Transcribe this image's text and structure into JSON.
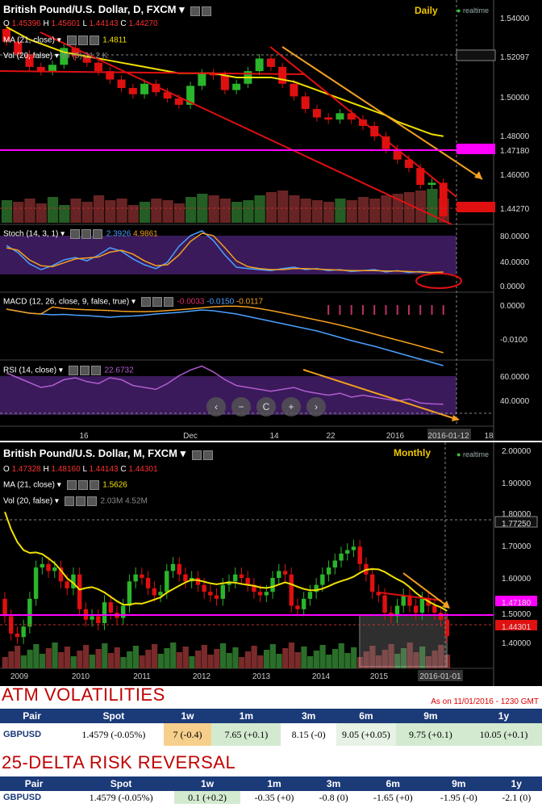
{
  "daily": {
    "title": "British Pound/U.S. Dollar, D, FXCM",
    "timeframe": "Daily",
    "realtime": "realtime",
    "ohlc": {
      "o_label": "O",
      "o": "1.45396",
      "h_label": "H",
      "h": "1.45601",
      "l_label": "L",
      "l": "1.44143",
      "c_label": "C",
      "c": "1.44270"
    },
    "ma_label": "MA (21, close)",
    "ma_value": "1.4811",
    "vol_label": "Vol (20, false)",
    "vol_values": "24 (5) 21.2 K",
    "stoch_label": "Stoch (14, 3, 1)",
    "stoch_values": [
      "2.3926",
      "4.9861"
    ],
    "macd_label": "MACD (12, 26, close, 9, false, true)",
    "macd_values": [
      "-0.0033",
      "-0.0150",
      "-0.0117"
    ],
    "rsi_label": "RSI (14, close)",
    "rsi_value": "22.6732",
    "x_labels": [
      "16",
      "Dec",
      "14",
      "22",
      "2016",
      "2016-01-12",
      "18"
    ],
    "price_axis": [
      "1.54000",
      "1.52097",
      "1.50000",
      "1.48000",
      "1.47180",
      "1.46000",
      "1.44270"
    ],
    "stoch_axis": [
      "80.0000",
      "40.0000",
      "0.0000"
    ],
    "macd_axis": [
      "0.0000",
      "-0.0100"
    ],
    "rsi_axis": [
      "60.0000",
      "40.0000"
    ]
  },
  "monthly": {
    "title": "British Pound/U.S. Dollar, M, FXCM",
    "timeframe": "Monthly",
    "realtime": "realtime",
    "ohlc": {
      "o_label": "O",
      "o": "1.47328",
      "h_label": "H",
      "h": "1.48160",
      "l_label": "L",
      "l": "1.44143",
      "c_label": "C",
      "c": "1.44301"
    },
    "ma_label": "MA (21, close)",
    "ma_value": "1.5626",
    "vol_label": "Vol (20, false)",
    "vol_values": "2.03M 4.52M",
    "x_labels": [
      "2009",
      "2010",
      "2011",
      "2012",
      "2013",
      "2014",
      "2015",
      "2016-01-01"
    ],
    "price_axis": [
      "2.00000",
      "1.90000",
      "1.80000",
      "1.77250",
      "1.70000",
      "1.60000",
      "1.50000",
      "1.47180",
      "1.44301",
      "1.40000"
    ]
  },
  "chart_data": [
    {
      "type": "line",
      "title": "British Pound/U.S. Dollar, D, FXCM",
      "series": [
        {
          "name": "Close",
          "values": [
            1.526,
            1.52,
            1.514,
            1.512,
            1.515,
            1.523,
            1.519,
            1.516,
            1.512,
            1.508,
            1.504,
            1.501,
            1.506,
            1.502,
            1.499,
            1.496,
            1.505,
            1.511,
            1.51,
            1.503,
            1.506,
            1.512,
            1.518,
            1.514,
            1.506,
            1.5,
            1.494,
            1.49,
            1.489,
            1.492,
            1.489,
            1.486,
            1.481,
            1.475,
            1.47,
            1.466,
            1.458,
            1.459,
            1.443
          ]
        },
        {
          "name": "MA (21, close)",
          "values": [
            1.533,
            1.53,
            1.527,
            1.525,
            1.523,
            1.521,
            1.52,
            1.519,
            1.518,
            1.517,
            1.516,
            1.515,
            1.514,
            1.513,
            1.512,
            1.511,
            1.511,
            1.511,
            1.511,
            1.51,
            1.509,
            1.509,
            1.509,
            1.509,
            1.508,
            1.507,
            1.505,
            1.503,
            1.501,
            1.499,
            1.497,
            1.495,
            1.493,
            1.491,
            1.488,
            1.486,
            1.484,
            1.482,
            1.4811
          ]
        }
      ],
      "xlabel": "",
      "ylabel": "",
      "ylim": [
        1.44,
        1.545
      ]
    },
    {
      "type": "line",
      "title": "British Pound/U.S. Dollar, M, FXCM",
      "series": [
        {
          "name": "Close",
          "values": [
            1.5,
            1.45,
            1.44,
            1.47,
            1.55,
            1.64,
            1.65,
            1.63,
            1.64,
            1.6,
            1.58,
            1.62,
            1.52,
            1.49,
            1.5,
            1.48,
            1.54,
            1.51,
            1.495,
            1.53,
            1.6,
            1.62,
            1.61,
            1.58,
            1.56,
            1.57,
            1.63,
            1.65,
            1.62,
            1.6,
            1.61,
            1.59,
            1.57,
            1.56,
            1.55,
            1.59,
            1.6,
            1.62,
            1.61,
            1.59,
            1.57,
            1.56,
            1.57,
            1.61,
            1.63,
            1.62,
            1.53,
            1.52,
            1.55,
            1.57,
            1.59,
            1.62,
            1.64,
            1.66,
            1.68,
            1.69,
            1.7,
            1.65,
            1.62,
            1.57,
            1.56,
            1.51,
            1.5,
            1.53,
            1.56,
            1.53,
            1.51,
            1.55,
            1.53,
            1.51,
            1.49,
            1.443
          ]
        }
      ],
      "xlabel": "",
      "ylabel": "",
      "ylim": [
        1.35,
        2.0
      ]
    }
  ],
  "vol_table": {
    "title": "ATM VOLATILITIES",
    "as_of": "As on 11/01/2016 - 1230 GMT",
    "headers": [
      "Pair",
      "Spot",
      "1w",
      "1m",
      "3m",
      "6m",
      "9m",
      "1y"
    ],
    "row": [
      "GBPUSD",
      "1.4579 (-0.05%)",
      "7 (-0.4)",
      "7.65 (+0.1)",
      "8.15 (-0)",
      "9.05 (+0.05)",
      "9.75 (+0.1)",
      "10.05 (+0.1)"
    ]
  },
  "rr_table": {
    "title": "25-DELTA RISK REVERSAL",
    "headers": [
      "Pair",
      "Spot",
      "1w",
      "1m",
      "3m",
      "6m",
      "9m",
      "1y"
    ],
    "row": [
      "GBPUSD",
      "1.4579 (-0.05%)",
      "0.1 (+0.2)",
      "-0.35 (+0)",
      "-0.8 (0)",
      "-1.65 (+0)",
      "-1.95 (-0)",
      "-2.1 (0)"
    ]
  },
  "colors": {
    "up": "#2bb52b",
    "down": "#e01010",
    "ma": "#f0e000",
    "magenta": "#ff00ff",
    "orange": "#f4a020",
    "stoch_fill": "#3a1a5a",
    "header_blue": "#1b3a78",
    "title_red": "#c00000",
    "vol_1w": "#f6cf8c",
    "vol_green": "#d3ead0"
  }
}
